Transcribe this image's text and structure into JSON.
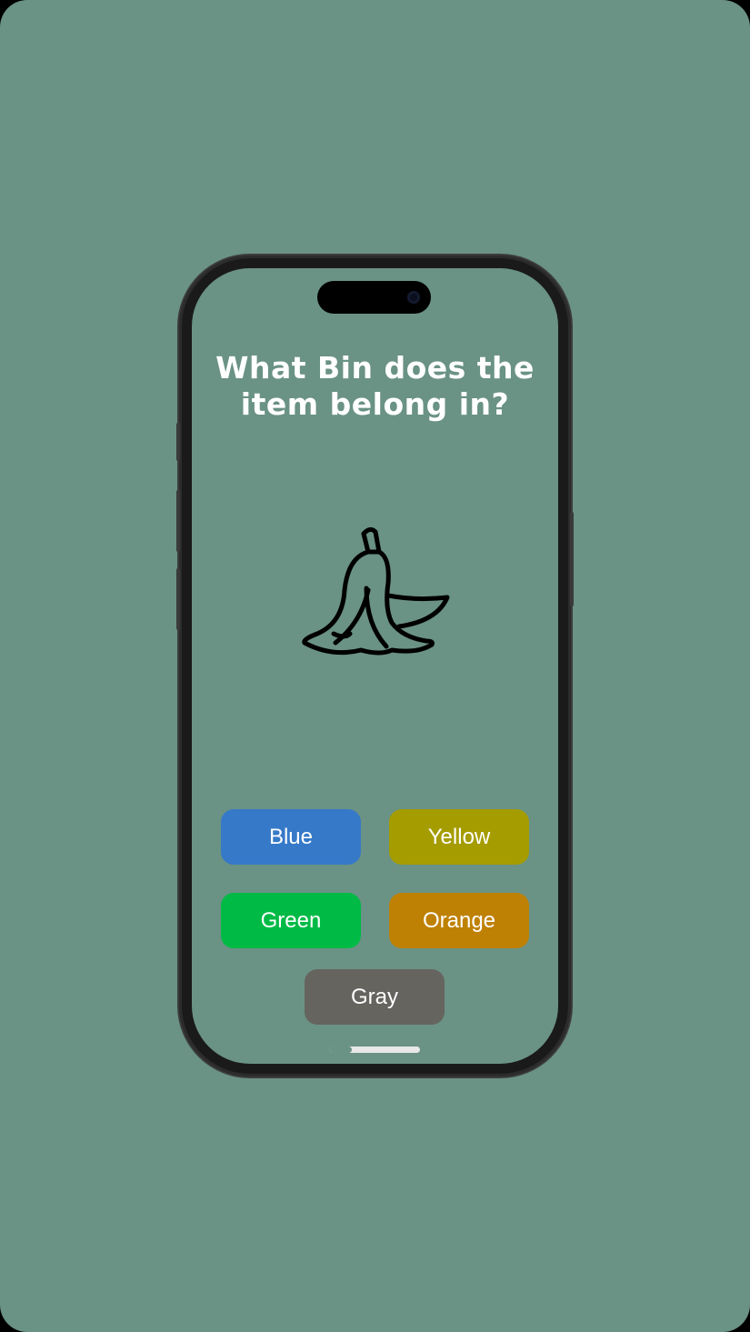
{
  "question": {
    "title": "What Bin does the item belong in?"
  },
  "item": {
    "icon": "banana-peel-icon"
  },
  "answers": {
    "blue": {
      "label": "Blue",
      "color": "#3679C8"
    },
    "yellow": {
      "label": "Yellow",
      "color": "#A59C00"
    },
    "green": {
      "label": "Green",
      "color": "#00BA46"
    },
    "orange": {
      "label": "Orange",
      "color": "#BF8104"
    },
    "gray": {
      "label": "Gray",
      "color": "#65645F"
    }
  },
  "colors": {
    "background": "#6A9285",
    "title_text": "#FFFFFF",
    "button_text": "#FFFFFF"
  }
}
